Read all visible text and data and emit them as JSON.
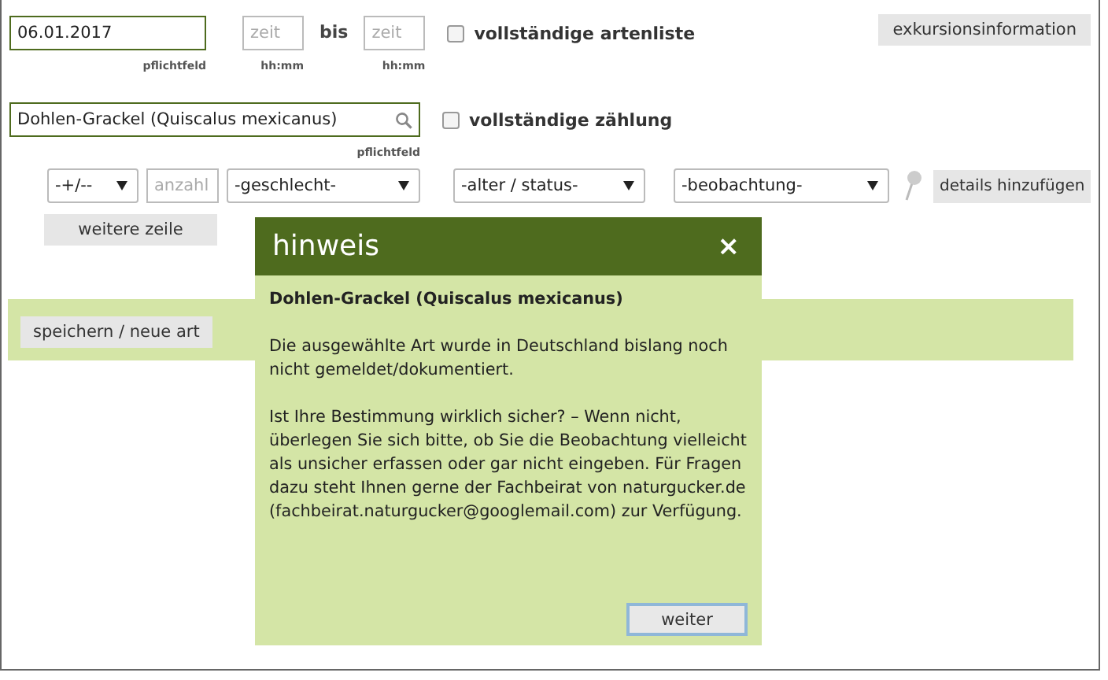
{
  "date_field": {
    "value": "06.01.2017",
    "hint": "pflichtfeld"
  },
  "time_from": {
    "placeholder": "zeit",
    "hint": "hh:mm"
  },
  "between_label": "bis",
  "time_to": {
    "placeholder": "zeit",
    "hint": "hh:mm"
  },
  "full_species_list": {
    "label": "vollständige artenliste",
    "checked": false
  },
  "excursion_button": "exkursionsinformation",
  "species_field": {
    "value": "Dohlen-Grackel (Quiscalus mexicanus)",
    "hint": "pflichtfeld"
  },
  "full_count": {
    "label": "vollständige zählung",
    "checked": false
  },
  "sign_select": "-+/--",
  "count_field": {
    "placeholder": "anzahl"
  },
  "selects": [
    "-geschlecht-",
    "-alter / status-",
    "-beobachtung-"
  ],
  "details_button": "details hinzufügen",
  "more_row_button": "weitere zeile",
  "save_button": "speichern / neue art",
  "dialog": {
    "title": "hinweis",
    "close": "×",
    "species": "Dohlen-Grackel (Quiscalus mexicanus)",
    "paragraphs": [
      "Die ausgewählte Art wurde in Deutschland bislang noch nicht gemeldet/dokumentiert.",
      "Ist Ihre Bestimmung wirklich sicher? – Wenn nicht, überlegen Sie sich bitte, ob Sie die Beobachtung vielleicht als unsicher erfassen oder gar nicht eingeben. Für Fragen dazu steht Ihnen gerne der Fachbeirat von naturgucker.de (fachbeirat.naturgucker@googlemail.com) zur Verfügung."
    ],
    "button": "weiter"
  }
}
